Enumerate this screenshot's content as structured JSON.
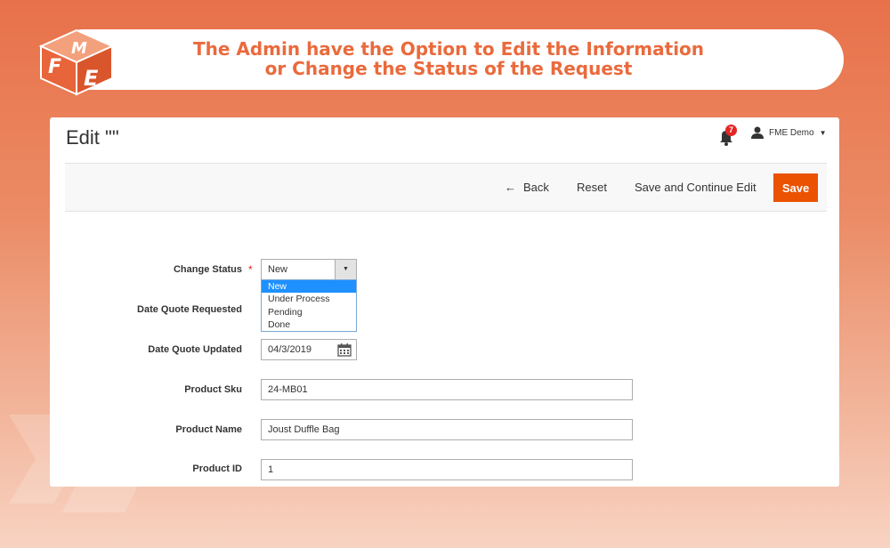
{
  "banner": {
    "line1": "The Admin have the Option to Edit the Information",
    "line2": "or Change the Status of the Request"
  },
  "logo": {
    "icon": "fme-logo-cube-icon",
    "letters": [
      "F",
      "M",
      "E"
    ]
  },
  "header": {
    "title": "Edit \"\"",
    "notifications_count": "7",
    "user_name": "FME Demo"
  },
  "actions": {
    "back": "Back",
    "reset": "Reset",
    "save_continue": "Save and Continue Edit",
    "save": "Save"
  },
  "form": {
    "change_status": {
      "label": "Change Status",
      "value": "New",
      "options": [
        "New",
        "Under Process",
        "Pending",
        "Done"
      ]
    },
    "date_quote_requested": {
      "label": "Date Quote Requested"
    },
    "date_quote_updated": {
      "label": "Date Quote Updated",
      "value": "04/3/2019"
    },
    "product_sku": {
      "label": "Product Sku",
      "value": "24-MB01"
    },
    "product_name": {
      "label": "Product Name",
      "value": "Joust Duffle Bag"
    },
    "product_id": {
      "label": "Product ID",
      "value": "1"
    }
  },
  "colors": {
    "accent": "#eb5202",
    "banner_text": "#ea6a3c",
    "badge": "#e22626",
    "dropdown_selected": "#1e90ff"
  }
}
